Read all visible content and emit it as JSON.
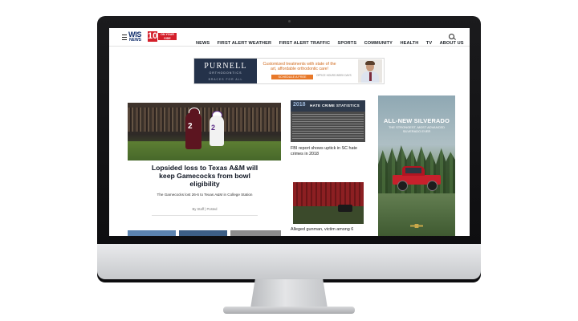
{
  "site": {
    "logo": {
      "wis": "WIS",
      "news": "NEWS",
      "channel": "10",
      "tagline": "ON YOUR SIDE"
    },
    "nav": [
      "NEWS",
      "FIRST ALERT WEATHER",
      "FIRST ALERT TRAFFIC",
      "SPORTS",
      "COMMUNITY",
      "HEALTH",
      "TV",
      "ABOUT US"
    ]
  },
  "ad_banner": {
    "brand": "PURNELL",
    "brand_sub": "ORTHODONTICS",
    "brand_sub2": "BRACES FOR ALL",
    "text": "Customized treatments with state of the art, affordable orthodontic care!",
    "cta": "SCHEDULE A FREE CONSULTATION",
    "small": "OFFICE HOURS\nWEEK DAYS"
  },
  "hero": {
    "title": "Lopsided loss to Texas A&M will keep Gamecocks from bowl eligibility",
    "subtitle": "The Gamecocks lost 26-6 to Texas A&M in College Station",
    "byline": "By Staff | Posted"
  },
  "mid_stories": [
    {
      "image_year": "2018",
      "image_title": "HATE CRIME STATISTICS",
      "caption": "FBI report shows uptick in SC hate crimes in 2018"
    },
    {
      "caption": "Alleged gunman, victim among 6"
    }
  ],
  "side_ad": {
    "title": "ALL-NEW SILVERADO",
    "subtitle": "THE STRONGEST, MOST ADVANCED SILVERADO EVER"
  },
  "colors": {
    "brand_red": "#d41f2b",
    "brand_navy": "#0f2d6b",
    "ad_orange": "#e8792a"
  },
  "icons": {
    "menu": "hamburger-icon",
    "search": "search-icon"
  }
}
